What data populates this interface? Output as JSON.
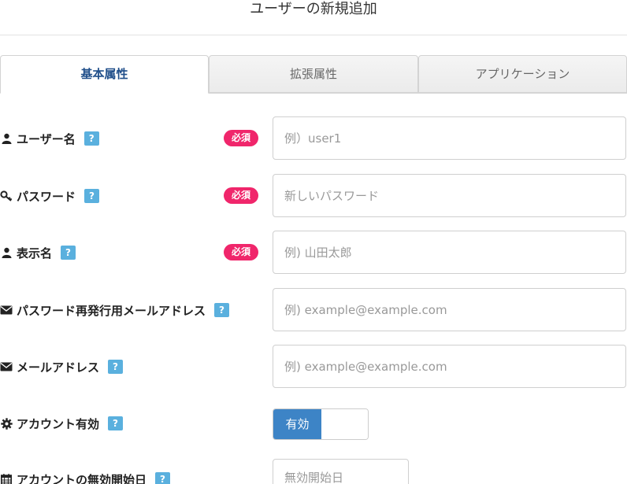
{
  "header": {
    "title": "ユーザーの新規追加"
  },
  "tabs": [
    {
      "label": "基本属性",
      "active": true
    },
    {
      "label": "拡張属性",
      "active": false
    },
    {
      "label": "アプリケーション",
      "active": false
    }
  ],
  "help_label": "?",
  "required_label": "必須",
  "fields": {
    "username": {
      "label": "ユーザー名",
      "icon": "user-icon",
      "required": true,
      "placeholder": "例）user1"
    },
    "password": {
      "label": "パスワード",
      "icon": "key-icon",
      "required": true,
      "placeholder": "新しいパスワード"
    },
    "display_name": {
      "label": "表示名",
      "icon": "user-icon",
      "required": true,
      "placeholder": "例) 山田太郎"
    },
    "reset_email": {
      "label": "パスワード再発行用メールアドレス",
      "icon": "envelope-icon",
      "required": false,
      "placeholder": "例) example@example.com"
    },
    "email": {
      "label": "メールアドレス",
      "icon": "envelope-icon",
      "required": false,
      "placeholder": "例) example@example.com"
    },
    "account_enabled": {
      "label": "アカウント有効",
      "icon": "gear-icon",
      "toggle_label": "有効",
      "enabled": true
    },
    "disable_start": {
      "label": "アカウントの無効開始日",
      "icon": "calendar-icon",
      "placeholder": "無効開始日"
    }
  },
  "colors": {
    "active_tab_text": "#1f4e8a",
    "required_badge": "#f0266b",
    "help_badge": "#5ab0de",
    "toggle_on": "#3d84c6"
  }
}
